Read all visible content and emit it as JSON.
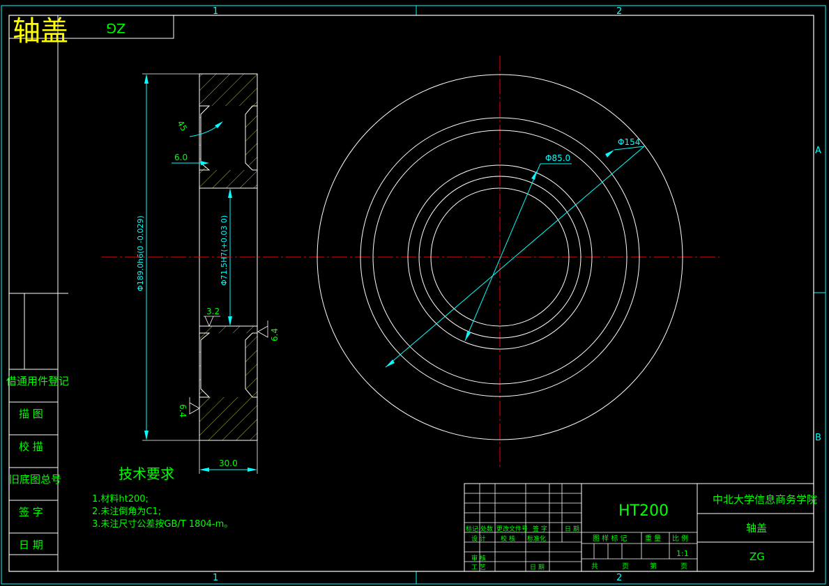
{
  "title": {
    "part_name": "轴盖",
    "code_mirrored": "ZG"
  },
  "zones": {
    "top": [
      "1",
      "2"
    ],
    "bottom": [
      "1",
      "2"
    ],
    "right": [
      "A",
      "B"
    ]
  },
  "left_panel": [
    "借通用件登记",
    "描 图",
    "校 描",
    "旧底图总号",
    "签 字",
    "日 期"
  ],
  "section_view": {
    "chamfer": "45",
    "groove_depth": "6.0",
    "outer_diameter": "Φ189.0h6(0 -0.029)",
    "bore_diameter": "Φ71.5H7(+0.03 0)",
    "roughness_1": "3.2",
    "roughness_2": "6.4",
    "roughness_3": "6.4",
    "width": "30.0"
  },
  "front_view": {
    "dim_small": "Φ85.0",
    "dim_large": "Φ154"
  },
  "tech_requirements": {
    "heading": "技术要求",
    "items": [
      "1.材料ht200;",
      "2.未注倒角为C1;",
      "3.未注尺寸公差按GB/T 1804-m。"
    ]
  },
  "title_block": {
    "material": "HT200",
    "institution": "中北大学信息商务学院",
    "drawing_name": "轴盖",
    "drawing_code": "ZG",
    "headers": [
      "标记",
      "处数",
      "更改文件号",
      "签 字",
      "日 期"
    ],
    "roles": [
      "设 计",
      "校 核",
      "标准化",
      "审 核",
      "工 艺",
      "日 期"
    ],
    "stage_mark": "图 样 标 记",
    "weight": "重 量",
    "scale_label": "比 例",
    "scale_value": "1:1",
    "total_label": "共",
    "page_label": "页",
    "sheet_label": "第",
    "sheet_page_label": "页"
  },
  "colors": {
    "frame": "#ffffff",
    "border": "#00ffff",
    "text": "#00ff00",
    "centerline": "#ff0000",
    "hatch": "#ffff00",
    "dimension": "#00ffff"
  }
}
